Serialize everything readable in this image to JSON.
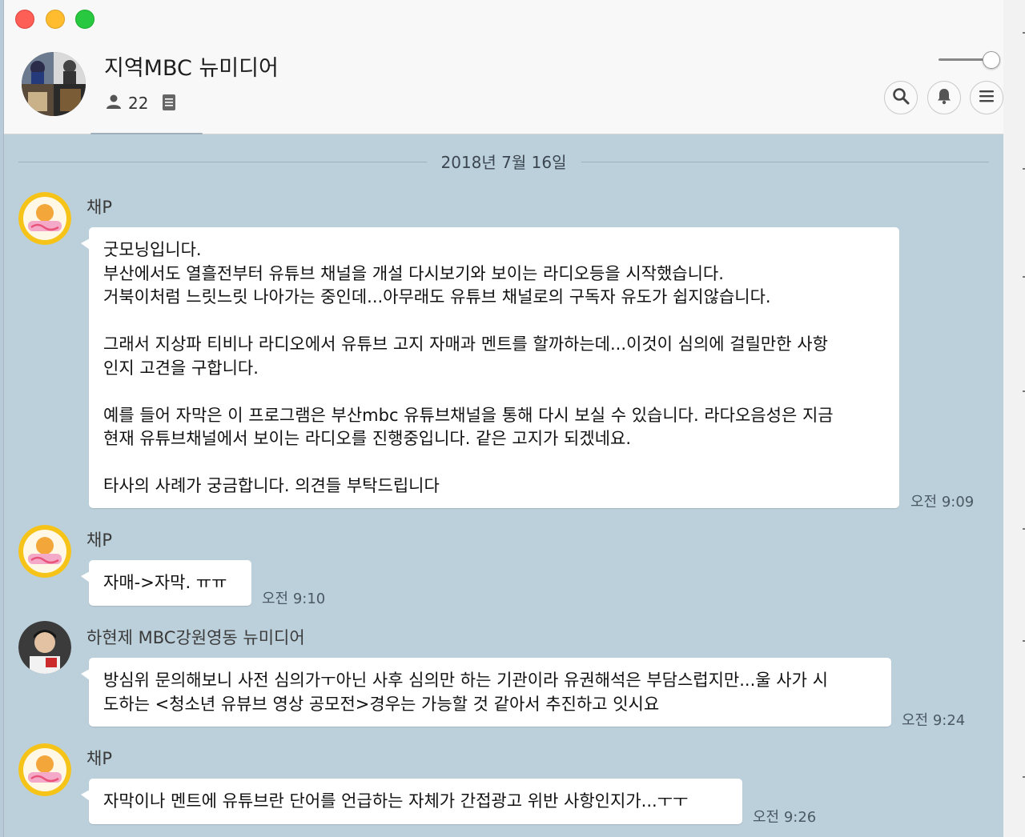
{
  "header": {
    "room_title": "지역MBC 뉴미디어",
    "member_count": "22",
    "icons": [
      "person-icon",
      "notes-icon",
      "search-icon",
      "bell-icon",
      "menu-icon"
    ]
  },
  "date_divider": "2018년 7월 16일",
  "messages": [
    {
      "sender": "채P",
      "text": "굿모닝입니다.\n부산에서도 열흘전부터 유튜브 채널을 개설 다시보기와 보이는 라디오등을 시작했습니다.\n거북이처럼 느릿느릿 나아가는 중인데...아무래도 유튜브 채널로의 구독자 유도가 쉽지않습니다.\n\n그래서 지상파 티비나 라디오에서 유튜브 고지 자매과 멘트를 할까하는데...이것이 심의에 걸릴만한 사항\n인지 고견을 구합니다.\n\n예를 들어 자막은 이 프로그램은 부산mbc 유튜브채널을 통해 다시 보실 수 있습니다. 라다오음성은 지금\n현재 유튜브채널에서 보이는 라디오를 진행중입니다. 같은 고지가 되겠네요.\n\n타사의 사례가 궁금합니다. 의견들 부탁드립니다",
      "time": "오전 9:09"
    },
    {
      "sender": "채P",
      "text": "자매->자막. ㅠㅠ",
      "time": "오전 9:10"
    },
    {
      "sender": "하현제 MBC강원영동 뉴미디어",
      "text": "방심위 문의해보니 사전 심의가ㅜ아닌 사후 심의만 하는 기관이라 유권해석은 부담스럽지만...울 사가 시\n도하는 <청소년 유뷰브 영상 공모전>경우는 가능할 것 같아서 추진하고 잇시요",
      "time": "오전 9:24"
    },
    {
      "sender": "채P",
      "text": "자막이나 멘트에 유튜브란 단어를 언급하는 자체가 간접광고 위반 사항인지가...ㅜㅜ",
      "time": "오전 9:26"
    }
  ],
  "colors": {
    "chat_background": "#bcd0db",
    "bubble": "#ffffff",
    "studio_avatar_ring": "#f5c21b"
  }
}
